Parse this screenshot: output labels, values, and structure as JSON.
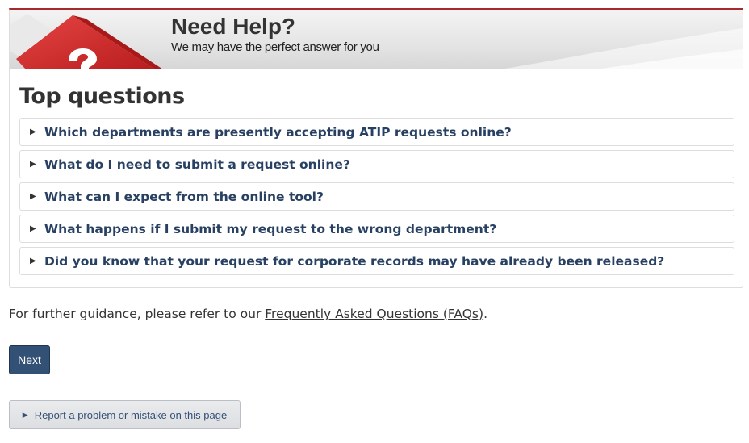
{
  "banner": {
    "title": "Need Help?",
    "subtitle": "We may have the perfect answer for you",
    "graphic_icon": "question-mark-key-icon",
    "colors": {
      "accent": "#a62a2a",
      "key_red": "#d12b2b"
    }
  },
  "top_questions": {
    "title": "Top questions",
    "items": [
      {
        "label": "Which departments are presently accepting ATIP requests online?"
      },
      {
        "label": "What do I need to submit a request online?"
      },
      {
        "label": "What can I expect from the online tool?"
      },
      {
        "label": "What happens if I submit my request to the wrong department?"
      },
      {
        "label": "Did you know that your request for corporate records may have already been released?"
      }
    ],
    "expand_icon": "triangle-right-icon"
  },
  "guidance": {
    "prefix": "For further guidance, please refer to our ",
    "link_text": "Frequently Asked Questions (FAQs)",
    "suffix": "."
  },
  "actions": {
    "next_label": "Next",
    "next_color": "#335075",
    "report_label": "Report a problem or mistake on this page"
  }
}
